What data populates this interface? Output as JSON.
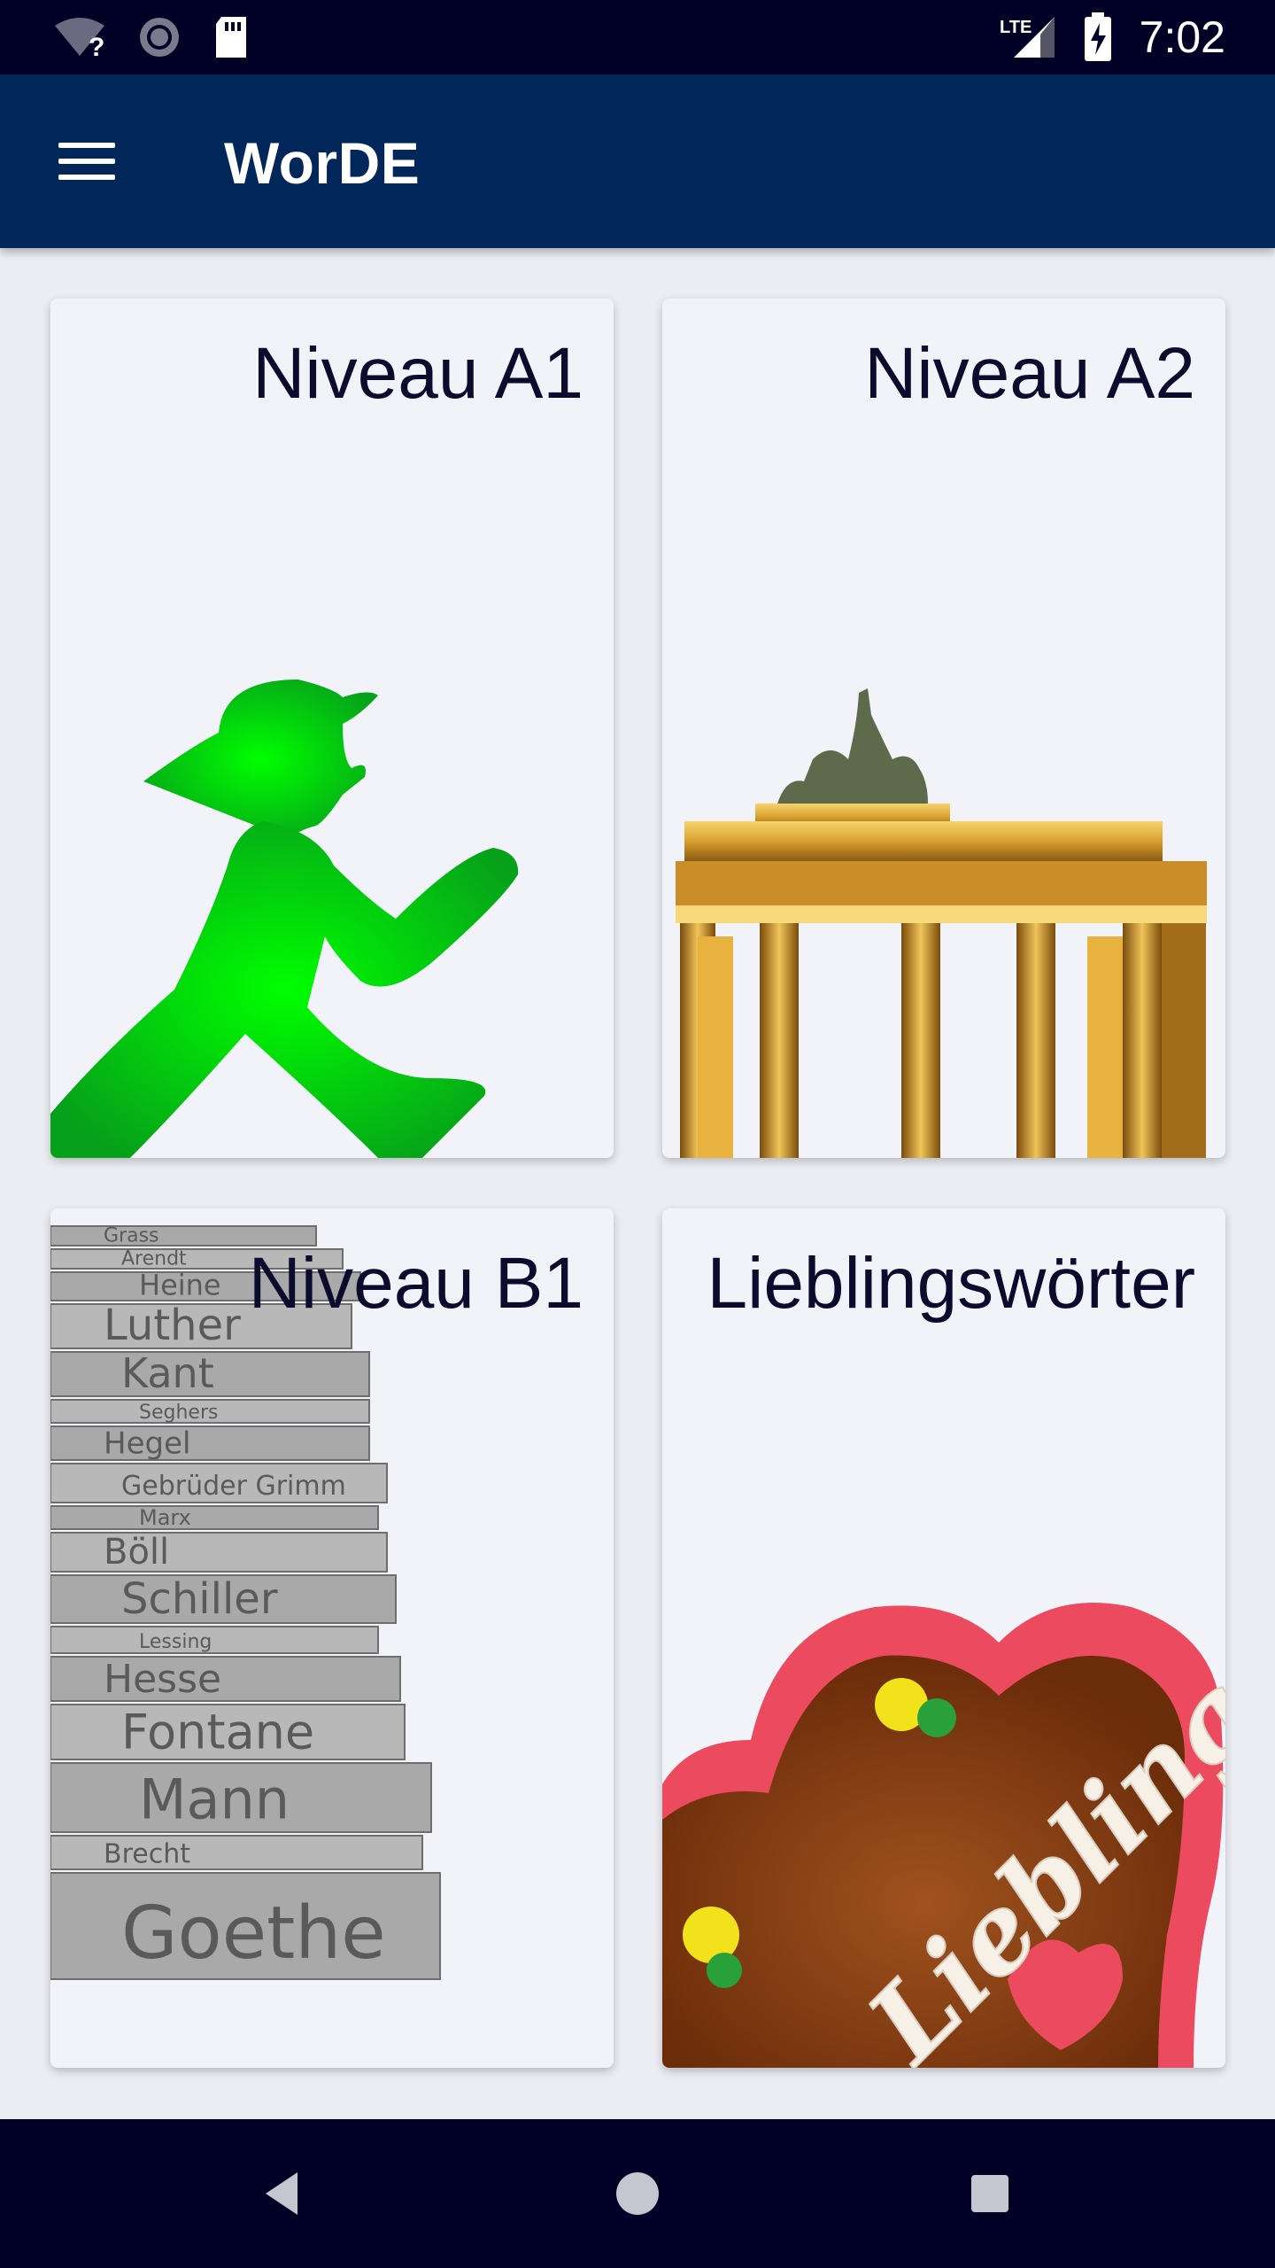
{
  "status_bar": {
    "time": "7:02",
    "network_label": "LTE",
    "icons": [
      "wifi-unknown-icon",
      "sync-icon",
      "sd-card-icon",
      "signal-icon",
      "battery-charging-icon"
    ]
  },
  "app_bar": {
    "title": "WorDE",
    "menu_icon": "hamburger-menu-icon"
  },
  "cards": [
    {
      "title": "Niveau A1",
      "image": "ampelmann-green-walking-man"
    },
    {
      "title": "Niveau A2",
      "image": "brandenburg-gate"
    },
    {
      "title": "Niveau B1",
      "image": "stack-of-books-german-authors"
    },
    {
      "title": "Lieblingswörter",
      "image": "gingerbread-heart-liebling"
    }
  ],
  "books": [
    "Grass",
    "Arendt",
    "Heine",
    "Luther",
    "Kant",
    "Seghers",
    "Hegel",
    "Gebrüder Grimm",
    "Marx",
    "Böll",
    "Schiller",
    "Lessing",
    "Hesse",
    "Fontane",
    "Mann",
    "Brecht",
    "Goethe"
  ],
  "heart_text": "Liebling",
  "nav_bar": {
    "back": "back-icon",
    "home": "home-icon",
    "recents": "recents-icon"
  },
  "colors": {
    "status_bar": "#000026",
    "app_bar": "#00265a",
    "background": "#ebedf2",
    "card": "#f1f3f8",
    "title_text": "#0b0b2e"
  }
}
